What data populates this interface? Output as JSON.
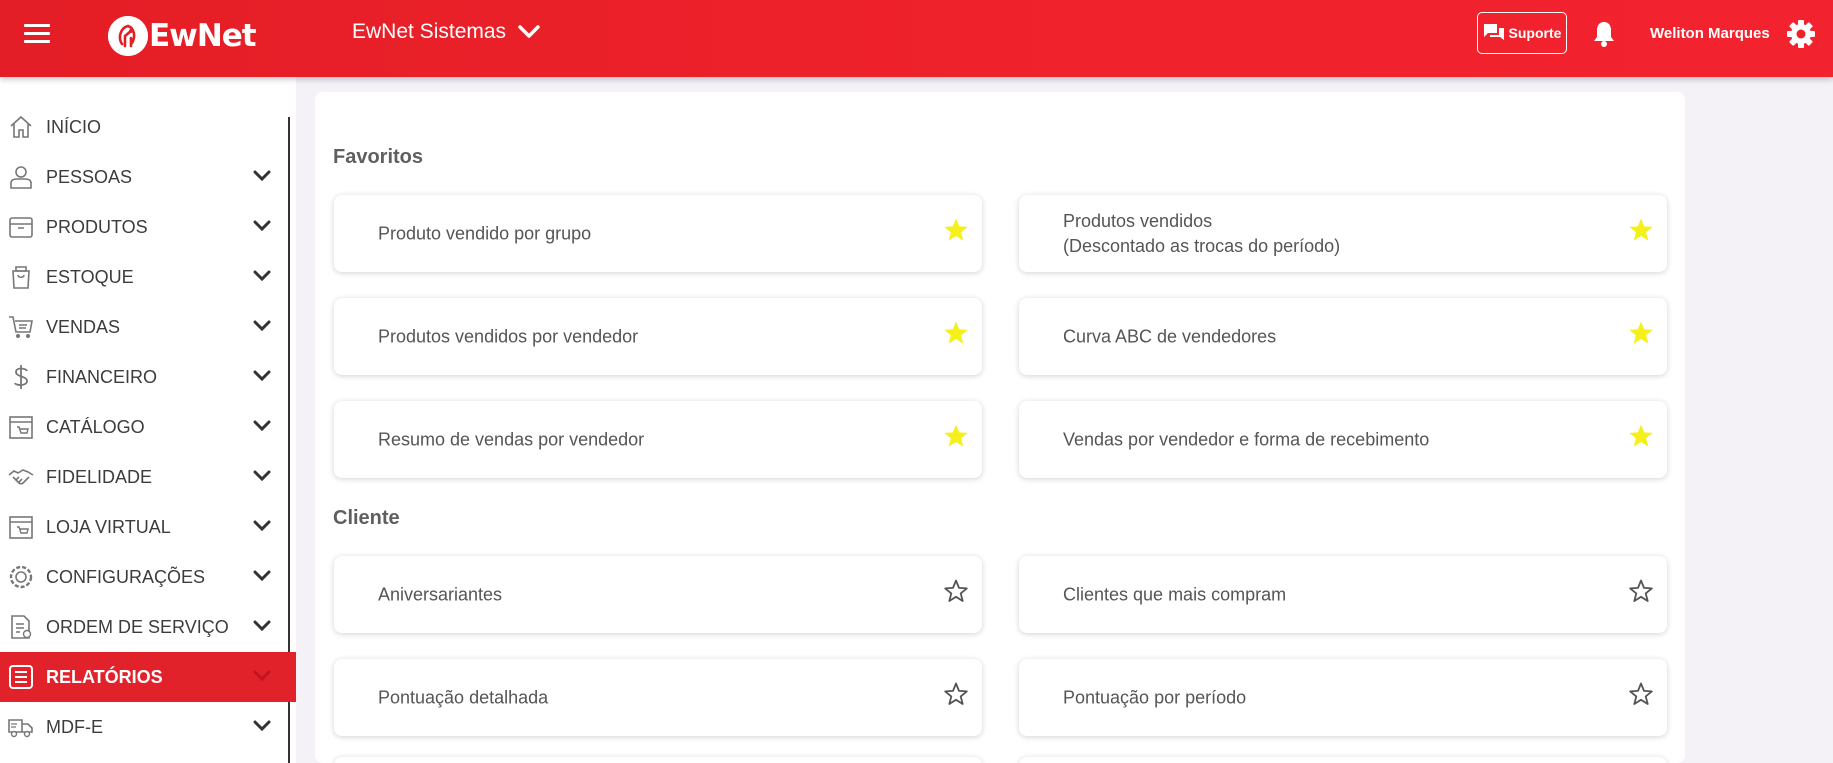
{
  "header": {
    "logo_text": "EwNet",
    "company": "EwNet Sistemas",
    "support_label": "Suporte",
    "username": "Weliton Marques"
  },
  "sidebar": {
    "items": [
      {
        "label": "INÍCIO",
        "icon": "home-icon",
        "expandable": false
      },
      {
        "label": "PESSOAS",
        "icon": "person-icon",
        "expandable": true
      },
      {
        "label": "PRODUTOS",
        "icon": "box-icon",
        "expandable": true
      },
      {
        "label": "ESTOQUE",
        "icon": "bag-icon",
        "expandable": true
      },
      {
        "label": "VENDAS",
        "icon": "cart-icon",
        "expandable": true
      },
      {
        "label": "FINANCEIRO",
        "icon": "dollar-icon",
        "expandable": true
      },
      {
        "label": "CATÁLOGO",
        "icon": "catalog-icon",
        "expandable": true
      },
      {
        "label": "FIDELIDADE",
        "icon": "handshake-icon",
        "expandable": true
      },
      {
        "label": "LOJA VIRTUAL",
        "icon": "store-icon",
        "expandable": true
      },
      {
        "label": "CONFIGURAÇÕES",
        "icon": "settings-icon",
        "expandable": true
      },
      {
        "label": "ORDEM DE SERVIÇO",
        "icon": "document-icon",
        "expandable": true
      },
      {
        "label": "RELATÓRIOS",
        "icon": "list-icon",
        "expandable": true,
        "active": true
      },
      {
        "label": "MDF-E",
        "icon": "truck-icon",
        "expandable": true
      }
    ]
  },
  "main": {
    "sections": [
      {
        "title": "Favoritos",
        "cards": [
          {
            "label": "Produto vendido por grupo",
            "favorite": true
          },
          {
            "label": "Produtos vendidos\n(Descontado as trocas do período)",
            "favorite": true
          },
          {
            "label": "Produtos vendidos por vendedor",
            "favorite": true
          },
          {
            "label": "Curva ABC de vendedores",
            "favorite": true
          },
          {
            "label": "Resumo de vendas por vendedor",
            "favorite": true
          },
          {
            "label": "Vendas por vendedor e forma de recebimento",
            "favorite": true
          }
        ]
      },
      {
        "title": "Cliente",
        "cards": [
          {
            "label": "Aniversariantes",
            "favorite": false
          },
          {
            "label": "Clientes que mais compram",
            "favorite": false
          },
          {
            "label": "Pontuação detalhada",
            "favorite": false
          },
          {
            "label": "Pontuação por período",
            "favorite": false
          }
        ]
      }
    ]
  },
  "colors": {
    "brand_red": "#e41e26",
    "star_filled": "#f5ef1a",
    "star_empty": "#555555"
  }
}
